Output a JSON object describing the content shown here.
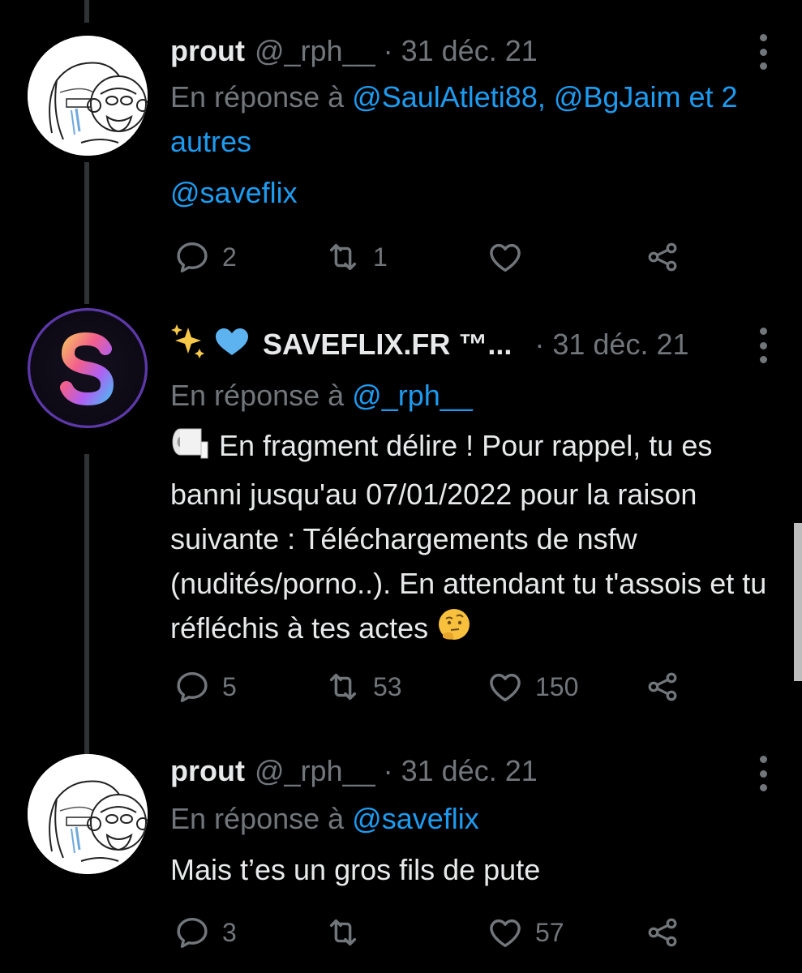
{
  "tweets": [
    {
      "name": "prout",
      "handle": "@_rph__",
      "dot": "·",
      "date": "31 déc. 21",
      "reply_prefix": "En réponse à",
      "reply_mentions": "@SaulAtleti88, @BgJaim et 2 autres",
      "text": "@saveflix",
      "replies": "2",
      "retweets": "1",
      "likes": ""
    },
    {
      "name_prefix_emoji": "✨💙",
      "name": "SAVEFLIX.FR ™...",
      "dot": "·",
      "date": "31 déc. 21",
      "reply_prefix": "En réponse à",
      "reply_mentions": "@_rph__",
      "text_emoji_start": "🧻",
      "text": "En fragment délire ! Pour rappel, tu es banni jusqu'au 07/01/2022 pour la raison suivante : Téléchargements de nsfw (nudités/porno..). En attendant tu t'assois et tu réfléchis à tes actes",
      "text_emoji_end": "🤔",
      "replies": "5",
      "retweets": "53",
      "likes": "150"
    },
    {
      "name": "prout",
      "handle": "@_rph__",
      "dot": "·",
      "date": "31 déc. 21",
      "reply_prefix": "En réponse à",
      "reply_mentions": "@saveflix",
      "text": "Mais t’es un gros fils de pute",
      "replies": "3",
      "retweets": "",
      "likes": "57"
    }
  ],
  "icons": {
    "reply": "reply-icon",
    "retweet": "retweet-icon",
    "like": "heart-icon",
    "share": "share-icon",
    "more": "more-options-icon"
  },
  "colors": {
    "background": "#000000",
    "text": "#e7e9ea",
    "muted": "#71767b",
    "link": "#1d9bf0"
  }
}
